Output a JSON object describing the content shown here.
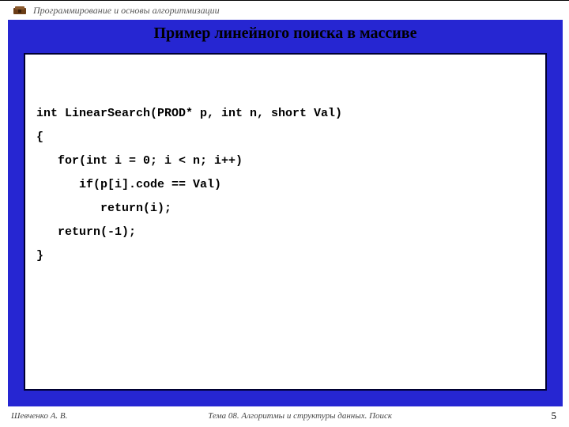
{
  "header": {
    "course_title": "Программирование и основы алгоритмизации"
  },
  "title": "Пример линейного поиска в массиве",
  "code": {
    "lines": [
      "int LinearSearch(PROD* p, int n, short Val)",
      "{",
      "   for(int i = 0; i < n; i++)",
      "      if(p[i].code == Val)",
      "         return(i);",
      "",
      "   return(-1);",
      "}"
    ]
  },
  "footer": {
    "author": "Шевченко А. В.",
    "topic": "Тема 08. Алгоритмы и структуры данных. Поиск",
    "page": "5"
  }
}
